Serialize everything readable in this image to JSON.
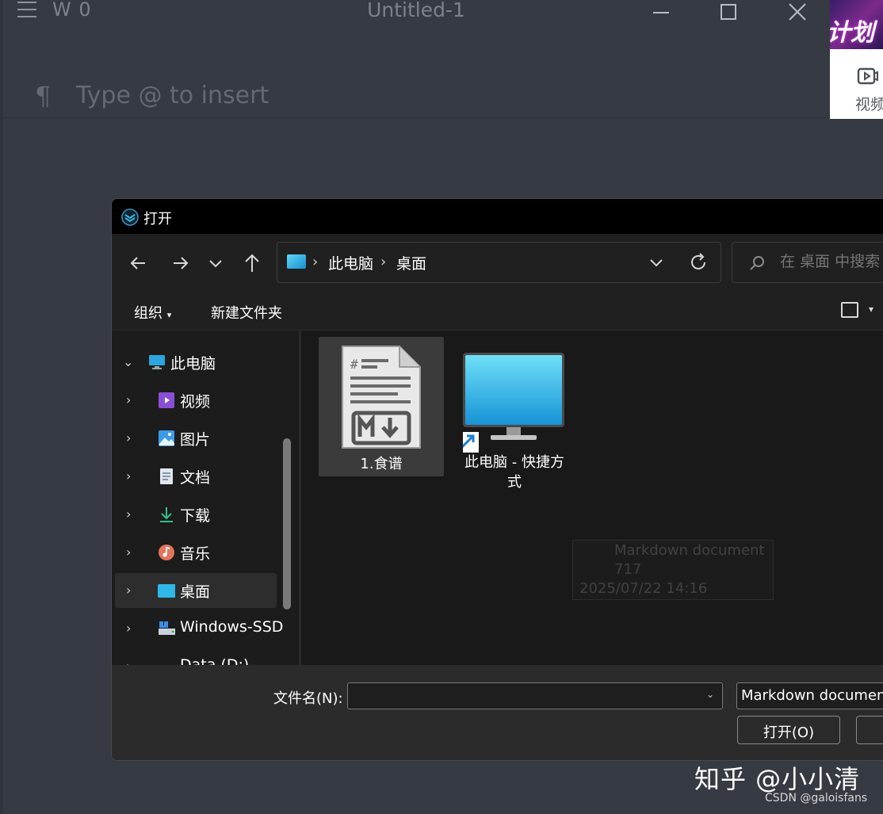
{
  "editor": {
    "word_count": "W 0",
    "title": "Untitled-1",
    "placeholder": "Type @ to insert",
    "paragraph_icon": "paragraph-icon",
    "menu_icon": "hamburger-menu-icon"
  },
  "web_strip": {
    "banner_text": "计划",
    "video_label": "视频"
  },
  "dialog": {
    "title": "打开",
    "breadcrumb": [
      "此电脑",
      "桌面"
    ],
    "search_placeholder": "在 桌面 中搜索",
    "toolbar": {
      "organize_label": "组织",
      "new_folder_label": "新建文件夹"
    },
    "tree": [
      {
        "label": "此电脑",
        "icon": "monitor-icon",
        "expanded": true
      },
      {
        "label": "视频",
        "icon": "video-icon"
      },
      {
        "label": "图片",
        "icon": "pictures-icon"
      },
      {
        "label": "文档",
        "icon": "document-icon"
      },
      {
        "label": "下载",
        "icon": "download-icon"
      },
      {
        "label": "音乐",
        "icon": "music-icon"
      },
      {
        "label": "桌面",
        "icon": "desktop-icon",
        "selected": true
      },
      {
        "label": "Windows-SSD",
        "icon": "drive-icon"
      },
      {
        "label": "Data (D:)",
        "icon": "drive-icon"
      }
    ],
    "files": [
      {
        "name": "1.食谱",
        "icon": "markdown-file-icon",
        "selected": true
      },
      {
        "name": "此电脑 - 快捷方式",
        "icon": "monitor-shortcut-icon"
      }
    ],
    "tooltip": {
      "type": "Markdown document",
      "size": "717",
      "date": "2025/07/22 14:16"
    },
    "footer": {
      "filename_label": "文件名(N):",
      "filename_value": "",
      "filter_value": "Markdown documents",
      "open_label": "打开(O)",
      "cancel_label": ""
    }
  },
  "watermarks": {
    "zhihu": "知乎 @小小清",
    "csdn": "CSDN @galoisfans"
  },
  "colors": {
    "editor_bg": "#363a42",
    "dialog_bg": "#202020",
    "titlebar_bg": "#000000",
    "accent_blue": "#2fb7e8"
  }
}
